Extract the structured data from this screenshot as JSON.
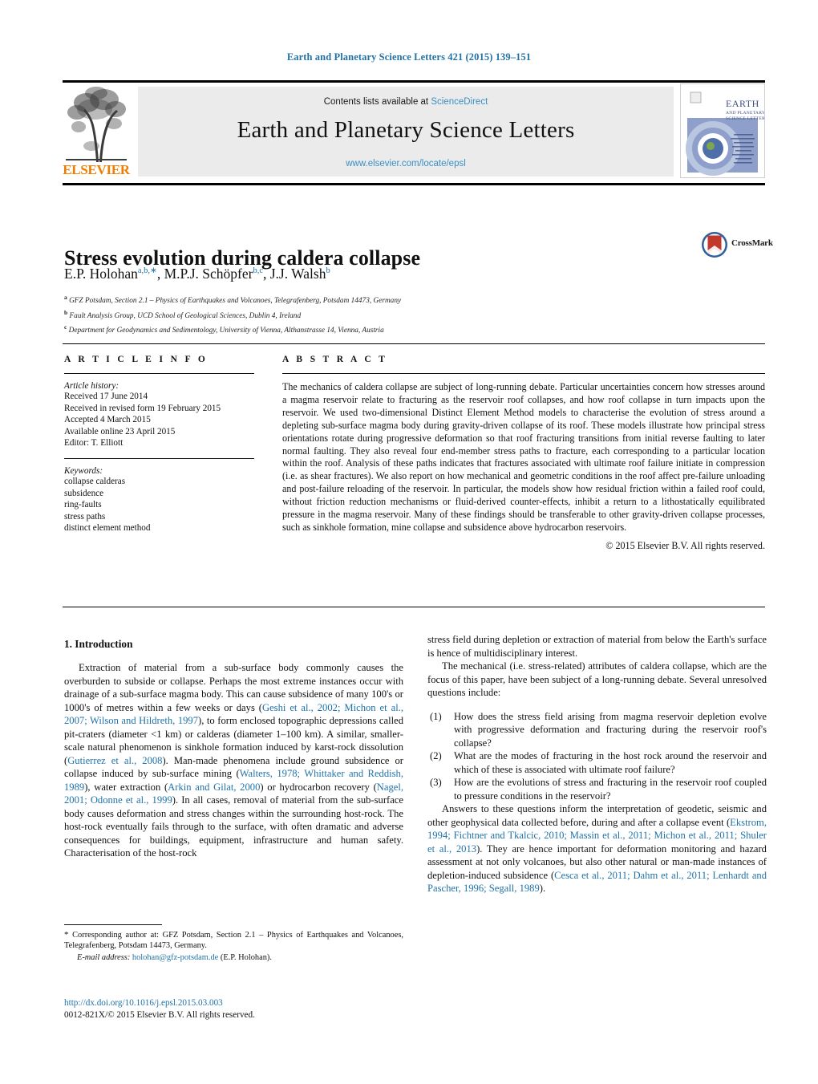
{
  "running_head": "Earth and Planetary Science Letters 421 (2015) 139–151",
  "masthead": {
    "publisher_name": "ELSEVIER",
    "contents_prefix": "Contents lists available at ",
    "sciencedirect": "ScienceDirect",
    "journal_title": "Earth and Planetary Science Letters",
    "journal_url": "www.elsevier.com/locate/epsl",
    "cover_title_line1": "EARTH",
    "cover_title_line2": "AND PLANETARY",
    "cover_title_line3": "SCIENCE LETTERS"
  },
  "article": {
    "title": "Stress evolution during caldera collapse",
    "authors": [
      {
        "name": "E.P. Holohan",
        "sup": "a,b,∗"
      },
      {
        "name": "M.P.J. Schöpfer",
        "sup": "b,c"
      },
      {
        "name": "J.J. Walsh",
        "sup": "b"
      }
    ],
    "affiliations": [
      {
        "label": "a",
        "text": "GFZ Potsdam, Section 2.1 – Physics of Earthquakes and Volcanoes, Telegrafenberg, Potsdam 14473, Germany"
      },
      {
        "label": "b",
        "text": "Fault Analysis Group, UCD School of Geological Sciences, Dublin 4, Ireland"
      },
      {
        "label": "c",
        "text": "Department for Geodynamics and Sedimentology, University of Vienna, Althanstrasse 14, Vienna, Austria"
      }
    ],
    "crossmark_label": "CrossMark"
  },
  "article_info": {
    "heading": "A R T I C L E I N F O",
    "history_label": "Article history:",
    "history": [
      "Received 17 June 2014",
      "Received in revised form 19 February 2015",
      "Accepted 4 March 2015",
      "Available online 23 April 2015",
      "Editor: T. Elliott"
    ],
    "keywords_label": "Keywords:",
    "keywords": [
      "collapse calderas",
      "subsidence",
      "ring-faults",
      "stress paths",
      "distinct element method"
    ]
  },
  "abstract": {
    "heading": "A B S T R A C T",
    "body": "The mechanics of caldera collapse are subject of long-running debate. Particular uncertainties concern how stresses around a magma reservoir relate to fracturing as the reservoir roof collapses, and how roof collapse in turn impacts upon the reservoir. We used two-dimensional Distinct Element Method models to characterise the evolution of stress around a depleting sub-surface magma body during gravity-driven collapse of its roof. These models illustrate how principal stress orientations rotate during progressive deformation so that roof fracturing transitions from initial reverse faulting to later normal faulting. They also reveal four end-member stress paths to fracture, each corresponding to a particular location within the roof. Analysis of these paths indicates that fractures associated with ultimate roof failure initiate in compression (i.e. as shear fractures). We also report on how mechanical and geometric conditions in the roof affect pre-failure unloading and post-failure reloading of the reservoir. In particular, the models show how residual friction within a failed roof could, without friction reduction mechanisms or fluid-derived counter-effects, inhibit a return to a lithostatically equilibrated pressure in the magma reservoir. Many of these findings should be transferable to other gravity-driven collapse processes, such as sinkhole formation, mine collapse and subsidence above hydrocarbon reservoirs.",
    "copyright": "© 2015 Elsevier B.V. All rights reserved."
  },
  "introduction": {
    "heading": "1. Introduction",
    "para1_parts": [
      {
        "t": "Extraction of material from a sub-surface body commonly causes the overburden to subside or collapse. Perhaps the most extreme instances occur with drainage of a sub-surface magma body. This can cause subsidence of many 100's or 1000's of metres within a few weeks or days (",
        "link": false
      },
      {
        "t": "Geshi et al., 2002; Michon et al., 2007; Wilson and Hildreth, 1997",
        "link": true
      },
      {
        "t": "), to form enclosed topographic depressions called pit-craters (diameter <1 km) or calderas (diameter 1–100 km). A similar, smaller-scale natural phenomenon is sinkhole formation induced by karst-rock dissolution (",
        "link": false
      },
      {
        "t": "Gutierrez et al., 2008",
        "link": true
      },
      {
        "t": "). Man-made phenomena include ground subsidence or collapse induced by sub-surface mining (",
        "link": false
      },
      {
        "t": "Walters, 1978; Whittaker and Reddish, 1989",
        "link": true
      },
      {
        "t": "), water extraction (",
        "link": false
      },
      {
        "t": "Arkin and Gilat, 2000",
        "link": true
      },
      {
        "t": ") or hydrocarbon recovery (",
        "link": false
      },
      {
        "t": "Nagel, 2001; Odonne et al., 1999",
        "link": true
      },
      {
        "t": "). In all cases, removal of material from the sub-surface body causes deformation and stress changes within the surrounding host-rock. The host-rock eventually fails through to the surface, with often dramatic and adverse consequences for buildings, equipment, infrastructure and human safety. Characterisation of the host-rock stress field during depletion or extraction of material from below the Earth's surface is hence of multidisciplinary interest.",
        "link": false
      }
    ],
    "para2": "The mechanical (i.e. stress-related) attributes of caldera collapse, which are the focus of this paper, have been subject of a long-running debate. Several unresolved questions include:",
    "questions": [
      {
        "num": "(1)",
        "text": "How does the stress field arising from magma reservoir depletion evolve with progressive deformation and fracturing during the reservoir roof's collapse?"
      },
      {
        "num": "(2)",
        "text": "What are the modes of fracturing in the host rock around the reservoir and which of these is associated with ultimate roof failure?"
      },
      {
        "num": "(3)",
        "text": "How are the evolutions of stress and fracturing in the reservoir roof coupled to pressure conditions in the reservoir?"
      }
    ],
    "para3_parts": [
      {
        "t": "Answers to these questions inform the interpretation of geodetic, seismic and other geophysical data collected before, during and after a collapse event (",
        "link": false
      },
      {
        "t": "Ekstrom, 1994; Fichtner and Tkalcic, 2010; Massin et al., 2011; Michon et al., 2011; Shuler et al., 2013",
        "link": true
      },
      {
        "t": "). They are hence important for deformation monitoring and hazard assessment at not only volcanoes, but also other natural or man-made instances of depletion-induced subsidence (",
        "link": false
      },
      {
        "t": "Cesca et al., 2011; Dahm et al., 2011; Lenhardt and Pascher, 1996; Segall, 1989",
        "link": true
      },
      {
        "t": ").",
        "link": false
      }
    ]
  },
  "footnotes": {
    "corresponding": "Corresponding author at: GFZ Potsdam, Section 2.1 – Physics of Earthquakes and Volcanoes, Telegrafenberg, Potsdam 14473, Germany.",
    "corresponding_star": "*",
    "email_label": "E-mail address:",
    "email": "holohan@gfz-potsdam.de",
    "email_owner": "(E.P. Holohan).",
    "doi": "http://dx.doi.org/10.1016/j.epsl.2015.03.003",
    "issn_line": "0012-821X/© 2015 Elsevier B.V. All rights reserved."
  },
  "colors": {
    "link": "#1f72a8",
    "elsevier_orange": "#f07d00",
    "banner_bg": "#ebebeb",
    "sciencedirect": "#3a8fc4"
  }
}
